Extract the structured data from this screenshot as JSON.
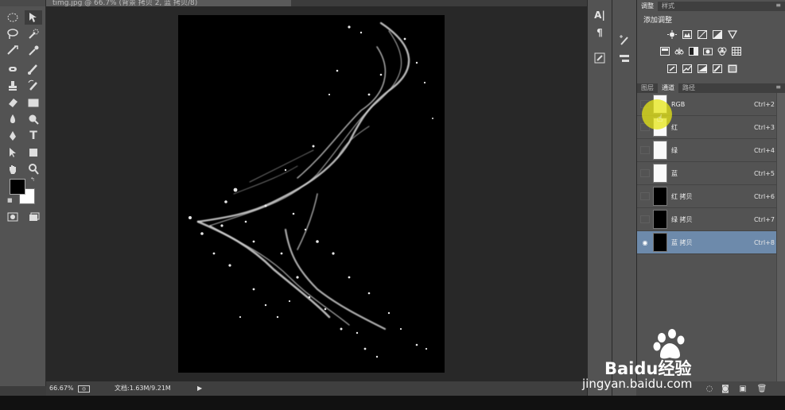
{
  "document": {
    "tab_title": "timg.jpg @ 66.7% (背景 拷贝 2, 蓝 拷贝/8)",
    "zoom": "66.67%",
    "doc_size": "文档:1.63M/9.21M"
  },
  "adjustments_panel": {
    "tabs": [
      "调整",
      "样式"
    ],
    "heading": "添加调整"
  },
  "channels_panel": {
    "tabs": [
      "图层",
      "通道",
      "路径"
    ],
    "channels": [
      {
        "name": "RGB",
        "shortcut": "Ctrl+2",
        "thumb": "light",
        "visible": false
      },
      {
        "name": "红",
        "shortcut": "Ctrl+3",
        "thumb": "light",
        "visible": false
      },
      {
        "name": "绿",
        "shortcut": "Ctrl+4",
        "thumb": "light",
        "visible": false
      },
      {
        "name": "蓝",
        "shortcut": "Ctrl+5",
        "thumb": "light",
        "visible": false
      },
      {
        "name": "红 拷贝",
        "shortcut": "Ctrl+6",
        "thumb": "dark",
        "visible": false
      },
      {
        "name": "绿 拷贝",
        "shortcut": "Ctrl+7",
        "thumb": "dark",
        "visible": false
      },
      {
        "name": "蓝 拷贝",
        "shortcut": "Ctrl+8",
        "thumb": "dark",
        "visible": true,
        "selected": true
      }
    ]
  },
  "tools": [
    "marquee-tool",
    "move-tool",
    "lasso-tool",
    "quick-select-tool",
    "crop-tool",
    "eyedropper-tool",
    "healing-brush-tool",
    "brush-tool",
    "clone-stamp-tool",
    "history-brush-tool",
    "eraser-tool",
    "gradient-tool",
    "blur-tool",
    "dodge-tool",
    "pen-tool",
    "type-tool",
    "path-select-tool",
    "shape-tool",
    "hand-tool",
    "zoom-tool"
  ],
  "colors": {
    "foreground": "#000000",
    "background": "#ffffff",
    "selection": "#6d8aab"
  },
  "watermark": {
    "brand": "Baidu经验",
    "url": "jingyan.baidu.com"
  }
}
